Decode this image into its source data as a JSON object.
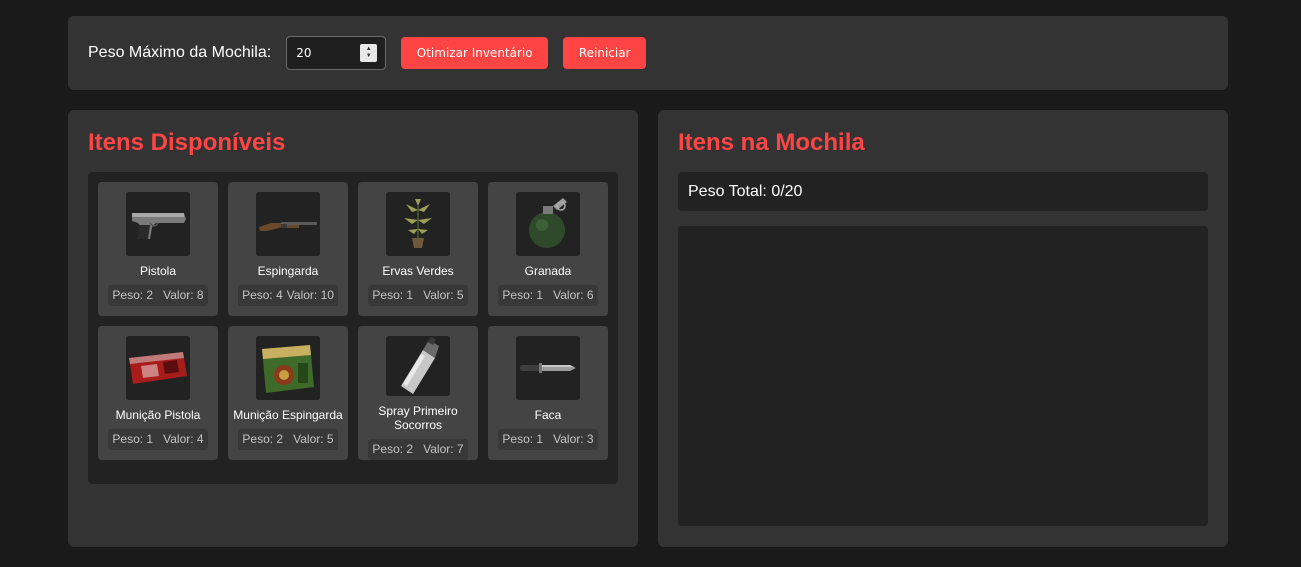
{
  "controls": {
    "max_weight_label": "Peso Máximo da Mochila:",
    "max_weight_value": "20",
    "optimize_label": "Otimizar Inventário",
    "reset_label": "Reiniciar"
  },
  "available": {
    "title": "Itens Disponíveis",
    "items": [
      {
        "name": "Pistola",
        "weight": "Peso: 2",
        "value": "Valor: 8",
        "icon": "pistol-icon"
      },
      {
        "name": "Espingarda",
        "weight": "Peso: 4",
        "value": "Valor: 10",
        "icon": "shotgun-icon"
      },
      {
        "name": "Ervas Verdes",
        "weight": "Peso: 1",
        "value": "Valor: 5",
        "icon": "green-herb-icon"
      },
      {
        "name": "Granada",
        "weight": "Peso: 1",
        "value": "Valor: 6",
        "icon": "grenade-icon"
      },
      {
        "name": "Munição Pistola",
        "weight": "Peso: 1",
        "value": "Valor: 4",
        "icon": "handgun-ammo-icon"
      },
      {
        "name": "Munição Espingarda",
        "weight": "Peso: 2",
        "value": "Valor: 5",
        "icon": "shotgun-ammo-icon"
      },
      {
        "name": "Spray Primeiro Socorros",
        "weight": "Peso: 2",
        "value": "Valor: 7",
        "icon": "first-aid-spray-icon"
      },
      {
        "name": "Faca",
        "weight": "Peso: 1",
        "value": "Valor: 3",
        "icon": "knife-icon"
      }
    ]
  },
  "backpack": {
    "title": "Itens na Mochila",
    "total_weight": "Peso Total: 0/20"
  },
  "colors": {
    "accent": "#ff4444",
    "background": "#1a1a1a",
    "panel": "#333333",
    "card": "#444444",
    "inset": "#222222"
  }
}
